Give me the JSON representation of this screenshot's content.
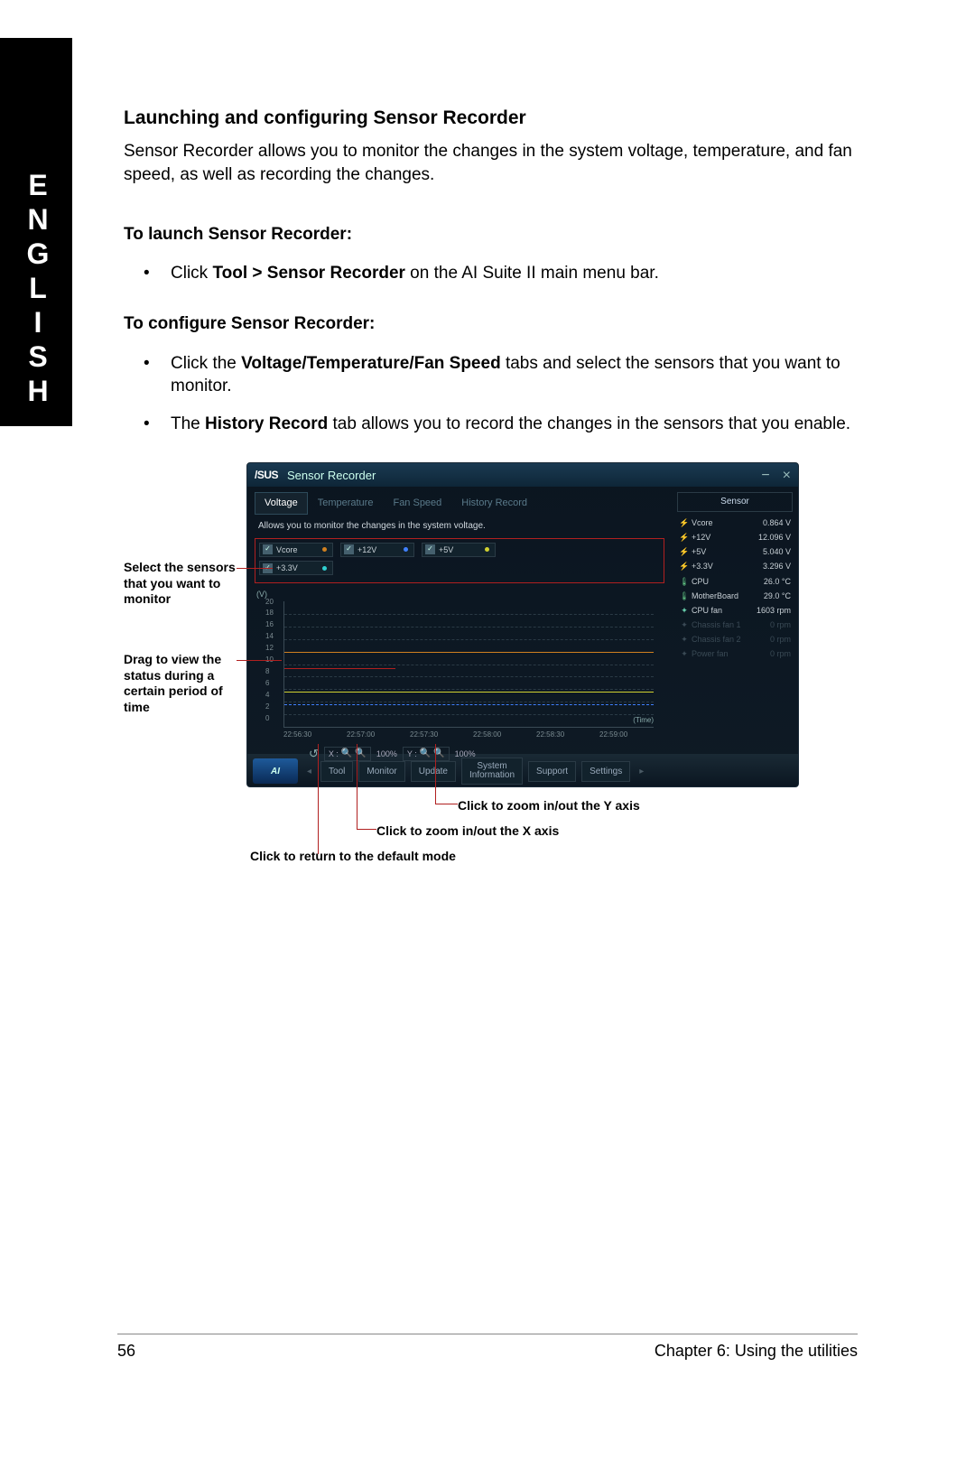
{
  "lang_tab": "ENGLISH",
  "heading": "Launching and configuring Sensor Recorder",
  "desc": "Sensor Recorder allows you to monitor the changes in the system voltage, temperature, and fan speed, as well as recording the changes.",
  "launch_head": "To launch Sensor Recorder:",
  "launch_li_pre": "Click ",
  "launch_li_bold": "Tool > Sensor Recorder",
  "launch_li_post": " on the AI Suite II main menu bar.",
  "config_head": "To configure Sensor Recorder:",
  "config_li1_pre": "Click the ",
  "config_li1_bold": "Voltage/Temperature/Fan Speed",
  "config_li1_post": " tabs and select the sensors that you want to monitor.",
  "config_li2_pre": "The ",
  "config_li2_bold": "History Record",
  "config_li2_post": " tab allows you to record the changes in the sensors that you enable.",
  "app": {
    "logo": "/SUS",
    "title": "Sensor Recorder",
    "min": "−",
    "close": "×",
    "tabs": {
      "voltage": "Voltage",
      "temperature": "Temperature",
      "fanspeed": "Fan Speed",
      "history": "History Record"
    },
    "hint": "Allows you to monitor the changes in the system voltage.",
    "checks": {
      "vcore": "Vcore",
      "v12": "+12V",
      "v5": "+5V",
      "v33": "+3.3V"
    },
    "check_mark": "✓",
    "graph": {
      "yunit": "(V)",
      "yticks": [
        "20",
        "18",
        "16",
        "14",
        "12",
        "10",
        "8",
        "6",
        "4",
        "2",
        "0"
      ],
      "xticks": [
        "22:56:30",
        "22:57:00",
        "22:57:30",
        "22:58:00",
        "22:58:30",
        "22:59:00"
      ],
      "time": "(Time)"
    },
    "zoom": {
      "reset": "↺",
      "xlabel": "X :",
      "ylabel": "Y :",
      "pct_x": "100%",
      "pct_y": "100%"
    },
    "sensor_head": "Sensor",
    "sensors": [
      {
        "ic": "s-v",
        "name": "Vcore",
        "val": "0.864 V"
      },
      {
        "ic": "s-v",
        "name": "+12V",
        "val": "12.096 V"
      },
      {
        "ic": "s-v",
        "name": "+5V",
        "val": "5.040 V"
      },
      {
        "ic": "s-v",
        "name": "+3.3V",
        "val": "3.296 V"
      },
      {
        "ic": "s-t",
        "name": "CPU",
        "val": "26.0 °C"
      },
      {
        "ic": "s-t",
        "name": "MotherBoard",
        "val": "29.0 °C"
      },
      {
        "ic": "s-f",
        "name": "CPU fan",
        "val": "1603 rpm"
      }
    ],
    "sensors_dim": [
      {
        "name": "Chassis fan 1",
        "val": "0 rpm"
      },
      {
        "name": "Chassis fan 2",
        "val": "0 rpm"
      },
      {
        "name": "Power fan",
        "val": "0 rpm"
      }
    ],
    "menus": {
      "tool": "Tool",
      "monitor": "Monitor",
      "update": "Update",
      "sysinfo": "System\nInformation",
      "support": "Support",
      "settings": "Settings",
      "ai": "AI"
    }
  },
  "callouts": {
    "c1": "Select the sensors that you want to monitor",
    "c2": "Drag to view the status during a certain period of time",
    "c3": "Click to zoom in/out the Y axis",
    "c4": "Click to zoom in/out the X axis",
    "c5": "Click to return to the default mode"
  },
  "footer": {
    "page": "56",
    "chapter": "Chapter 6: Using the utilities"
  }
}
